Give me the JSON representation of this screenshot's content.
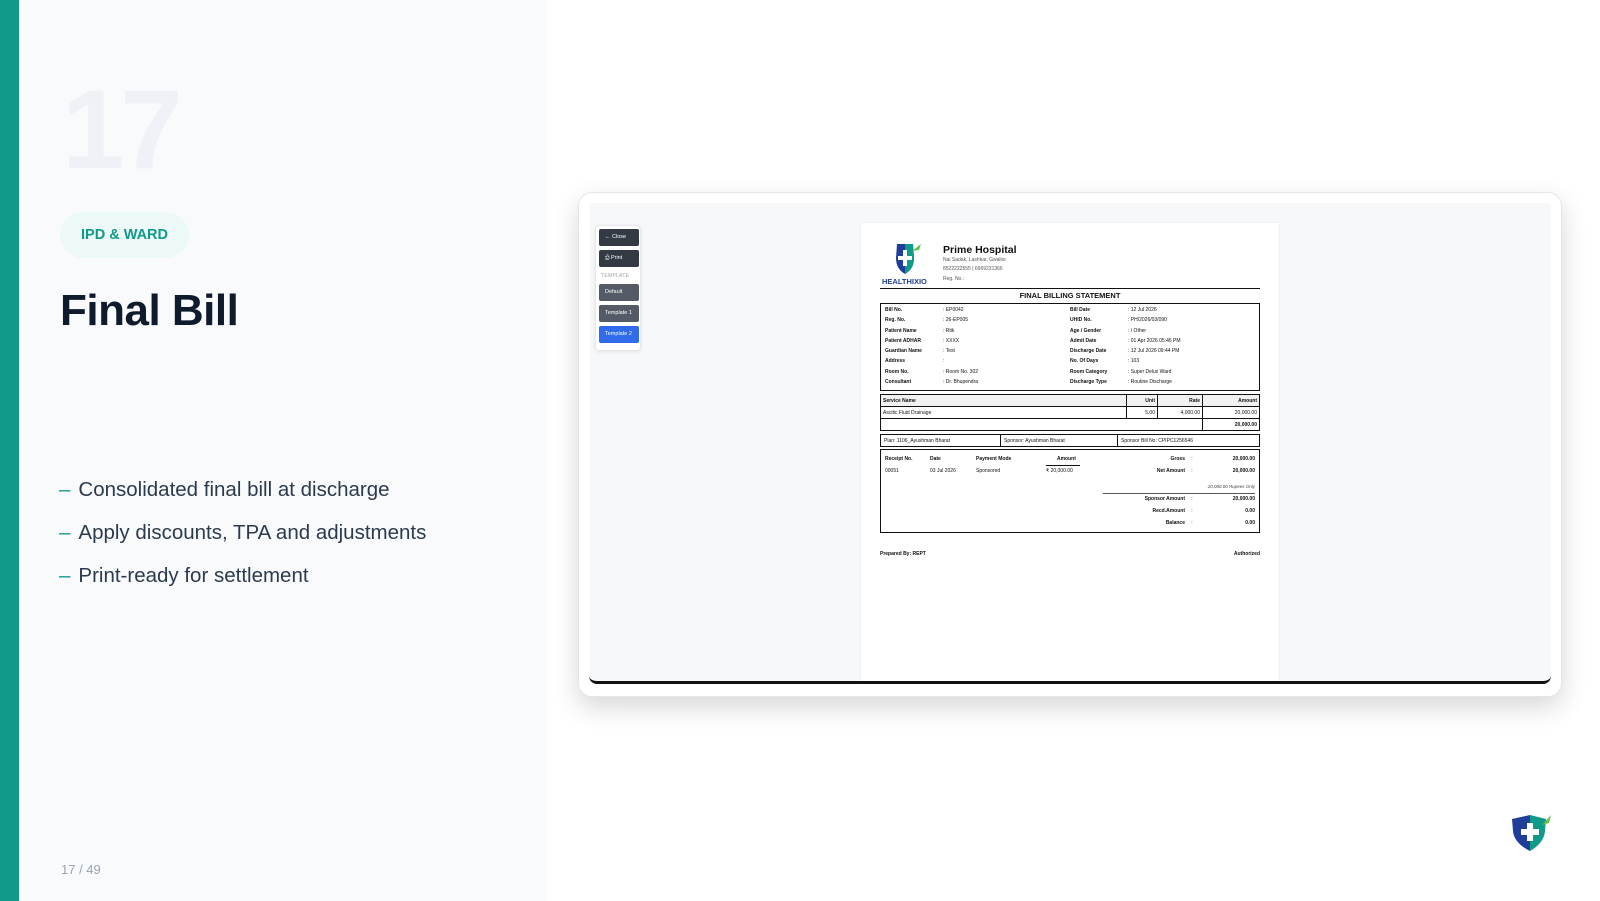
{
  "slide": {
    "number": "17",
    "tag": "IPD & WARD",
    "title": "Final Bill",
    "bullets": [
      "Consolidated final bill at discharge",
      "Apply discounts, TPA and adjustments",
      "Print-ready for settlement"
    ],
    "bullet_marker": "–",
    "pager": "17 / 49"
  },
  "toolbar": {
    "close_label": "Close",
    "print_label": "Print",
    "template_heading": "TEMPLATE",
    "templates": [
      "Default",
      "Template 1",
      "Template 2"
    ],
    "active_template": "Template 2"
  },
  "bill": {
    "logo_text": "HEALTHIXIO",
    "hospital_name": "Prime Hospital",
    "address": "Nai Sadak, Lashkar, Gwalior",
    "phone": "8522222555 | 6969231366",
    "reg": "Reg. No.:",
    "statement_title": "FINAL BILLING STATEMENT",
    "info_left": [
      {
        "k": "Bill No.",
        "v": ": EP0042"
      },
      {
        "k": "Reg. No.",
        "v": ": 26-EP005"
      },
      {
        "k": "Patient Name",
        "v": ": Rtik"
      },
      {
        "k": "Patient ADHAR",
        "v": ": XXXX"
      },
      {
        "k": "Guardian Name",
        "v": ": Test"
      },
      {
        "k": "Address",
        "v": ":"
      },
      {
        "k": "Room No.",
        "v": ": Room No. 302"
      },
      {
        "k": "Consultant",
        "v": ": Dr. Bhupendra"
      }
    ],
    "info_right": [
      {
        "k": "Bill Date",
        "v": ": 12 Jul 2026"
      },
      {
        "k": "UHID No.",
        "v": ": PH/2026/03/090"
      },
      {
        "k": "Age / Gender",
        "v": ": / Other"
      },
      {
        "k": "Admit Date",
        "v": ": 01 Apr 2026 05:46 PM"
      },
      {
        "k": "Discharge Date",
        "v": ": 12 Jul 2026 09:44 PM"
      },
      {
        "k": "No. Of Days",
        "v": ": 103"
      },
      {
        "k": "Room Category",
        "v": ": Super Delux Ward"
      },
      {
        "k": "Discharge Type",
        "v": ": Routine Discharge"
      }
    ],
    "service_headers": {
      "name": "Service Name",
      "unit": "Unit",
      "rate": "Rate",
      "amount": "Amount"
    },
    "services": [
      {
        "name": "Ascitic Fluid Drainage",
        "unit": "5.00",
        "rate": "4,000.00",
        "amount": "20,000.00"
      }
    ],
    "service_total": "20,000.00",
    "plan": {
      "plan": "Plan: 1106_Ayushman Bharat",
      "sponsor": "Sponsor: Ayushman Bharat",
      "sponsor_bill": "Sponsor Bill No: CPIPC1256546"
    },
    "receipt_headers": {
      "no": "Receipt No.",
      "date": "Date",
      "mode": "Payment Mode",
      "amount": "Amount"
    },
    "receipts": [
      {
        "no": "00051",
        "date": "03 Jul 2026",
        "mode": "Sponsored",
        "amount": "₹ 20,000.00"
      }
    ],
    "totals": {
      "gross_k": "Gross",
      "gross_v": "20,000.00",
      "net_k": "Net Amount",
      "net_v": "20,000.00",
      "words": "20,000.00 Rupees Only",
      "sponsor_k": "Sponsor Amount",
      "sponsor_v": "20,000.00",
      "recd_k": "Recd.Amount",
      "recd_v": "0.00",
      "balance_k": "Balance",
      "balance_v": "0.00",
      "sep": ":"
    },
    "prepared_by": "Prepared By: REPT",
    "authorized": "Authorized"
  },
  "colors": {
    "accent": "#0f9a8a",
    "title": "#0f1b2d",
    "active_template": "#2f6bea"
  }
}
